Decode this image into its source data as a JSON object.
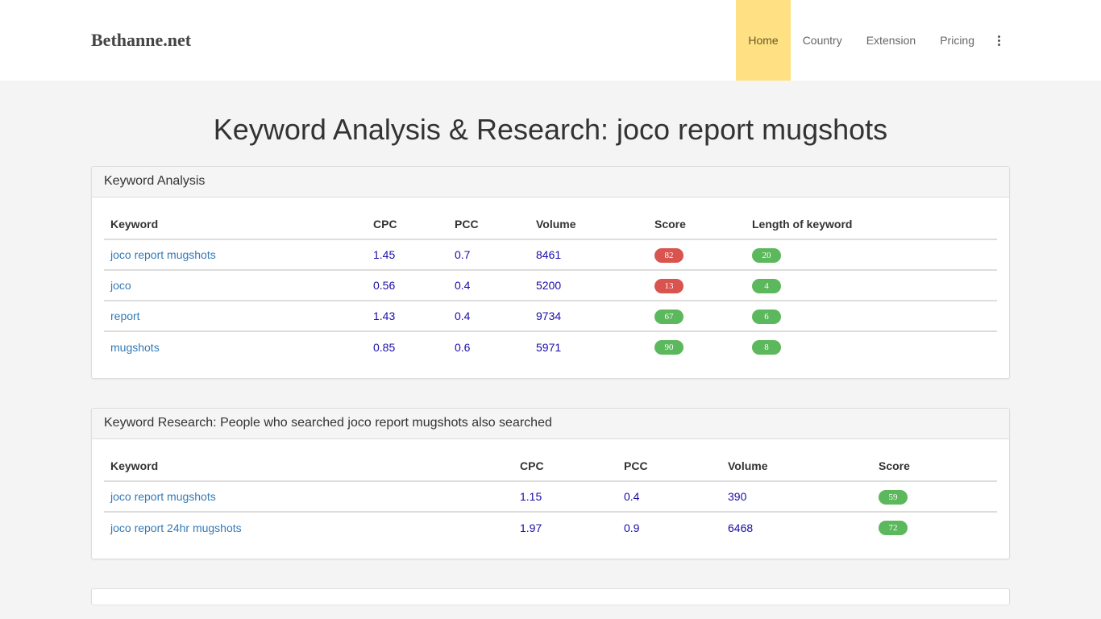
{
  "site": {
    "brand": "Bethanne.net",
    "nav": [
      {
        "label": "Home",
        "active": true
      },
      {
        "label": "Country",
        "active": false
      },
      {
        "label": "Extension",
        "active": false
      },
      {
        "label": "Pricing",
        "active": false
      }
    ],
    "more_icon": "vertical-ellipsis-icon"
  },
  "page": {
    "title": "Keyword Analysis & Research: joco report mugshots"
  },
  "analysis": {
    "heading": "Keyword Analysis",
    "columns": [
      "Keyword",
      "CPC",
      "PCC",
      "Volume",
      "Score",
      "Length of keyword"
    ],
    "rows": [
      {
        "keyword": "joco report mugshots",
        "cpc": "1.45",
        "pcc": "0.7",
        "volume": "8461",
        "score": "82",
        "score_color": "red",
        "length": "20"
      },
      {
        "keyword": "joco",
        "cpc": "0.56",
        "pcc": "0.4",
        "volume": "5200",
        "score": "13",
        "score_color": "red",
        "length": "4"
      },
      {
        "keyword": "report",
        "cpc": "1.43",
        "pcc": "0.4",
        "volume": "9734",
        "score": "67",
        "score_color": "green",
        "length": "6"
      },
      {
        "keyword": "mugshots",
        "cpc": "0.85",
        "pcc": "0.6",
        "volume": "5971",
        "score": "90",
        "score_color": "green",
        "length": "8"
      }
    ]
  },
  "research": {
    "heading": "Keyword Research: People who searched joco report mugshots also searched",
    "columns": [
      "Keyword",
      "CPC",
      "PCC",
      "Volume",
      "Score"
    ],
    "rows": [
      {
        "keyword": "joco report mugshots",
        "cpc": "1.15",
        "pcc": "0.4",
        "volume": "390",
        "score": "59",
        "score_color": "green"
      },
      {
        "keyword": "joco report 24hr mugshots",
        "cpc": "1.97",
        "pcc": "0.9",
        "volume": "6468",
        "score": "72",
        "score_color": "green"
      }
    ]
  },
  "colors": {
    "nav_active_bg": "#ffe082",
    "badge_red": "#d9534f",
    "badge_green": "#5cb85c",
    "link": "#337ab7",
    "value": "#1a0dab"
  }
}
